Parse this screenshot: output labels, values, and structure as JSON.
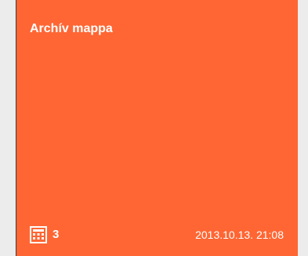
{
  "tile": {
    "title": "Archív mappa",
    "count": "3",
    "count_icon": "grid-icon",
    "timestamp": "2013.10.13. 21:08",
    "color": "#ff6633"
  }
}
